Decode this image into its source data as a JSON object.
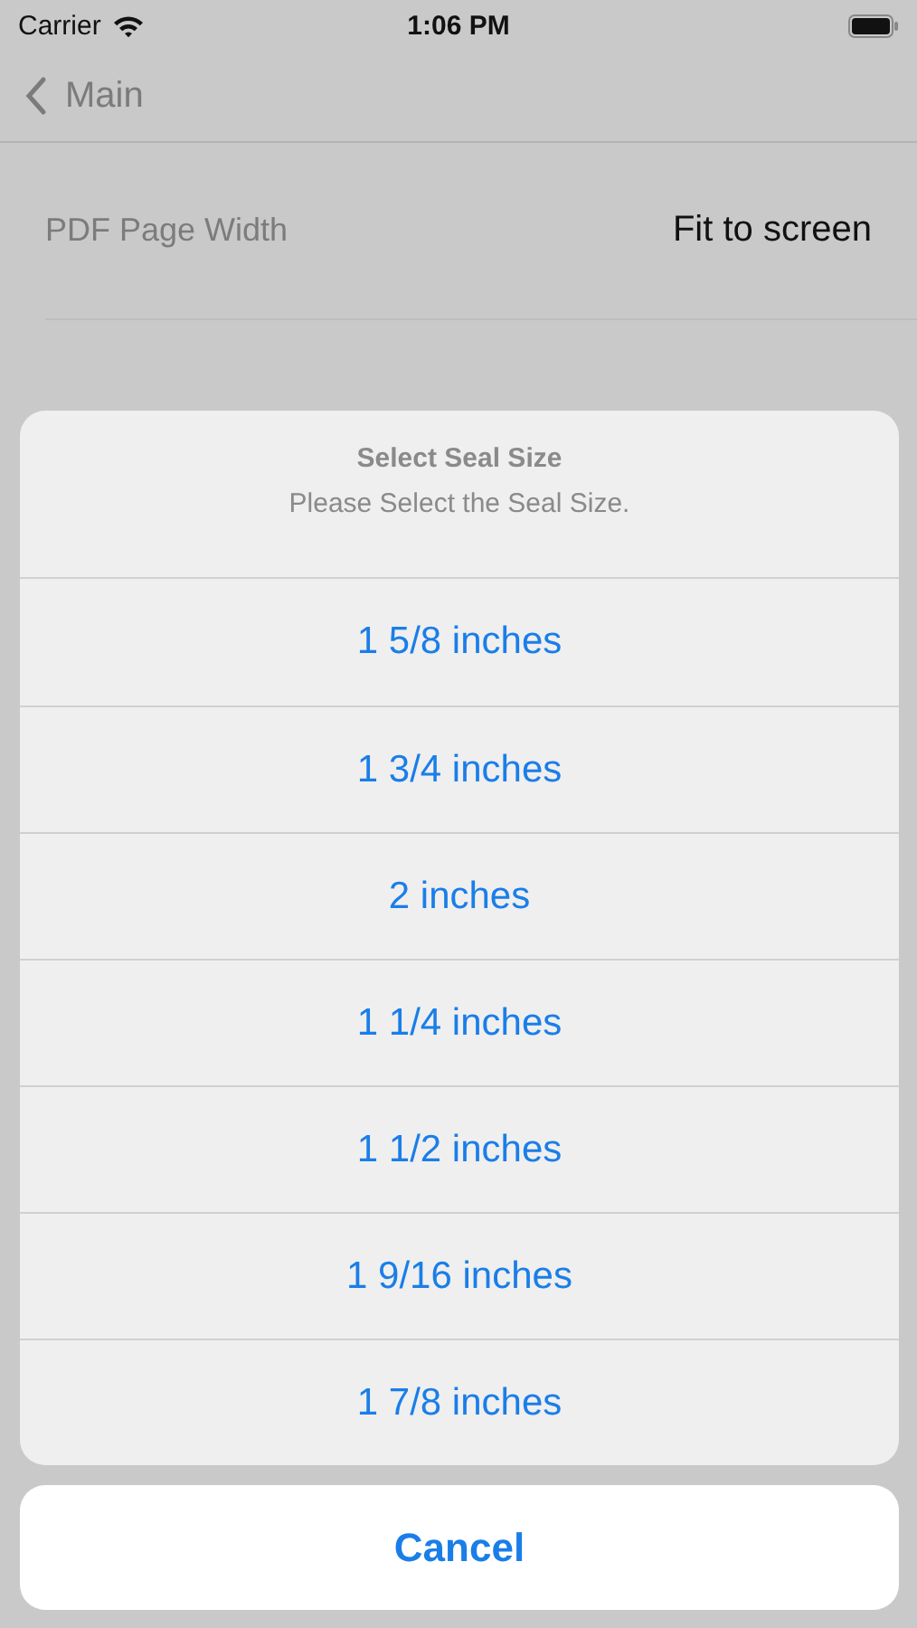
{
  "status_bar": {
    "carrier": "Carrier",
    "time": "1:06 PM"
  },
  "nav_bar": {
    "back_label": "Main"
  },
  "settings": [
    {
      "label": "PDF Page Width",
      "value": "Fit to screen"
    }
  ],
  "action_sheet": {
    "title": "Select Seal Size",
    "message": "Please Select the Seal Size.",
    "options": [
      "1 5/8 inches",
      "1 3/4 inches",
      "2 inches",
      "1 1/4 inches",
      "1 1/2 inches",
      "1 9/16 inches",
      "1 7/8 inches"
    ],
    "cancel": "Cancel"
  }
}
